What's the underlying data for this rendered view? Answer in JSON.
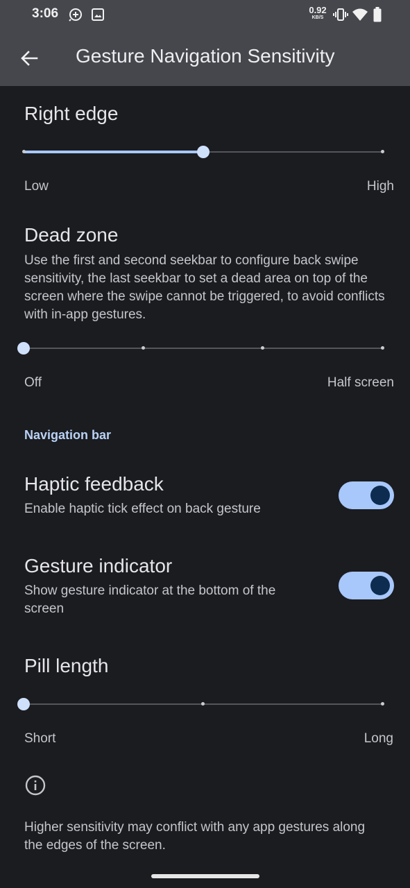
{
  "status_bar": {
    "time": "3:06",
    "net_speed_value": "0.92",
    "net_speed_unit": "KB/S",
    "icons": [
      "sync-plus-icon",
      "gallery-icon",
      "vibrate-icon",
      "wifi-icon",
      "battery-icon"
    ]
  },
  "app_bar": {
    "back_icon": "arrow-back-icon",
    "title": "Gesture Navigation Sensitivity"
  },
  "right_edge": {
    "title": "Right edge",
    "slider_value": 0.5,
    "low_label": "Low",
    "high_label": "High"
  },
  "dead_zone": {
    "title": "Dead zone",
    "description": "Use the first and second seekbar to configure back swipe sensitivity, the last seekbar to set a dead area on top of the screen where the swipe cannot be triggered, to avoid conflicts with in-app gestures.",
    "slider_value": 0,
    "slider_steps": 3,
    "min_label": "Off",
    "max_label": "Half screen"
  },
  "navigation_bar": {
    "section_title": "Navigation bar",
    "haptic": {
      "title": "Haptic feedback",
      "summary": "Enable haptic tick effect on back gesture",
      "enabled": true
    },
    "indicator": {
      "title": "Gesture indicator",
      "summary": "Show gesture indicator at the bottom of the screen",
      "enabled": true
    },
    "pill_length": {
      "title": "Pill length",
      "slider_value": 0,
      "slider_steps": 2,
      "min_label": "Short",
      "max_label": "Long"
    }
  },
  "footer": {
    "info_icon": "info-icon",
    "note": "Higher sensitivity may conflict with any app gestures along the edges of the screen."
  },
  "colors": {
    "background": "#1b1c20",
    "app_bar": "#45474c",
    "accent": "#a8c7fa",
    "toggle_knob": "#0d2c4f"
  }
}
